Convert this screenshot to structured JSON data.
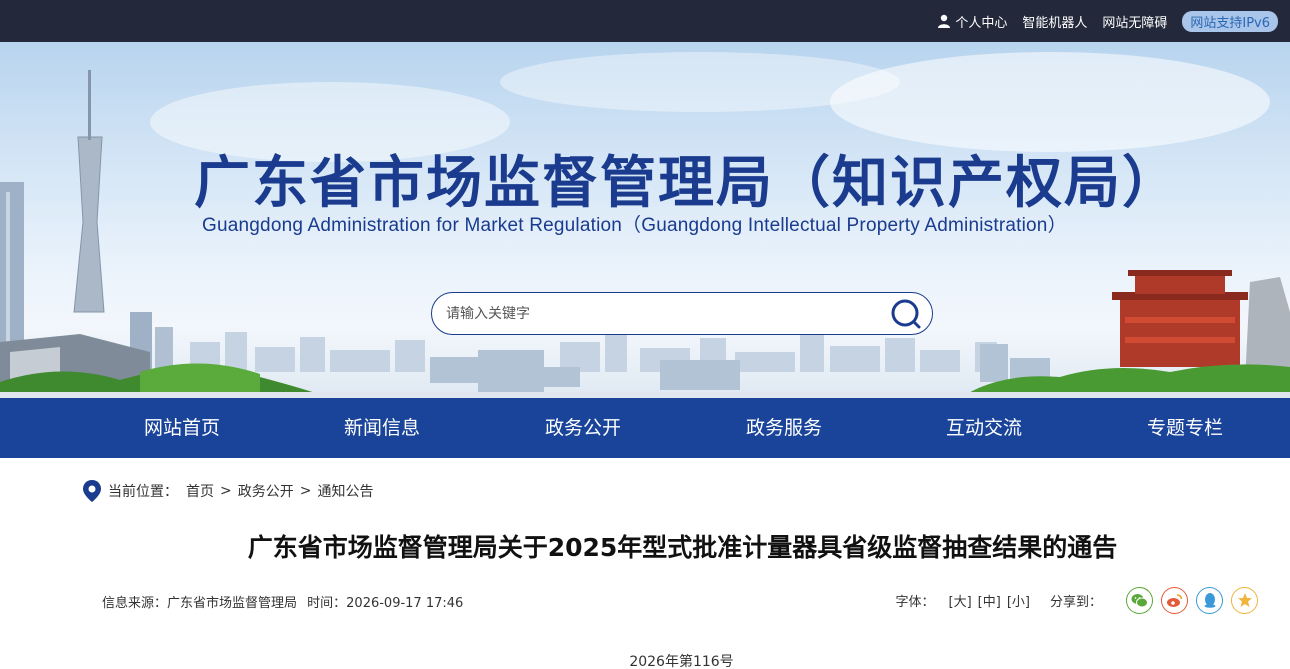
{
  "topbar": {
    "personal_center": "个人中心",
    "robot": "智能机器人",
    "accessibility": "网站无障碍",
    "ipv6": "网站支持IPv6"
  },
  "banner": {
    "title_cn": "广东省市场监督管理局（知识产权局）",
    "title_en": "Guangdong Administration for Market Regulation（Guangdong Intellectual Property Administration）"
  },
  "search": {
    "placeholder": "请输入关键字"
  },
  "nav": {
    "items": [
      {
        "label": "网站首页"
      },
      {
        "label": "新闻信息"
      },
      {
        "label": "政务公开"
      },
      {
        "label": "政务服务"
      },
      {
        "label": "互动交流"
      },
      {
        "label": "专题专栏"
      }
    ]
  },
  "breadcrumb": {
    "prefix": "当前位置：",
    "items": [
      "首页",
      "政务公开",
      "通知公告"
    ],
    "separator": ">"
  },
  "article": {
    "title": "广东省市场监督管理局关于2025年型式批准计量器具省级监督抽查结果的通告",
    "source_label": "信息来源：广东省市场监督管理局",
    "time_label": "时间：2026-09-17 17:46",
    "doc_number": "2026年第116号"
  },
  "tools": {
    "font_label": "字体：",
    "font_large": "[大]",
    "font_medium": "[中]",
    "font_small": "[小]",
    "share_label": "分享到：",
    "share_icons": [
      "wechat-icon",
      "weibo-icon",
      "qq-icon",
      "qzone-icon"
    ]
  },
  "colors": {
    "topbar": "#23283a",
    "nav": "#1a449a",
    "brand_blue": "#1a3b8e",
    "wechat": "#5aa83a",
    "weibo": "#e35a3a",
    "qq": "#3a9ad9",
    "qzone": "#f0b43a"
  }
}
